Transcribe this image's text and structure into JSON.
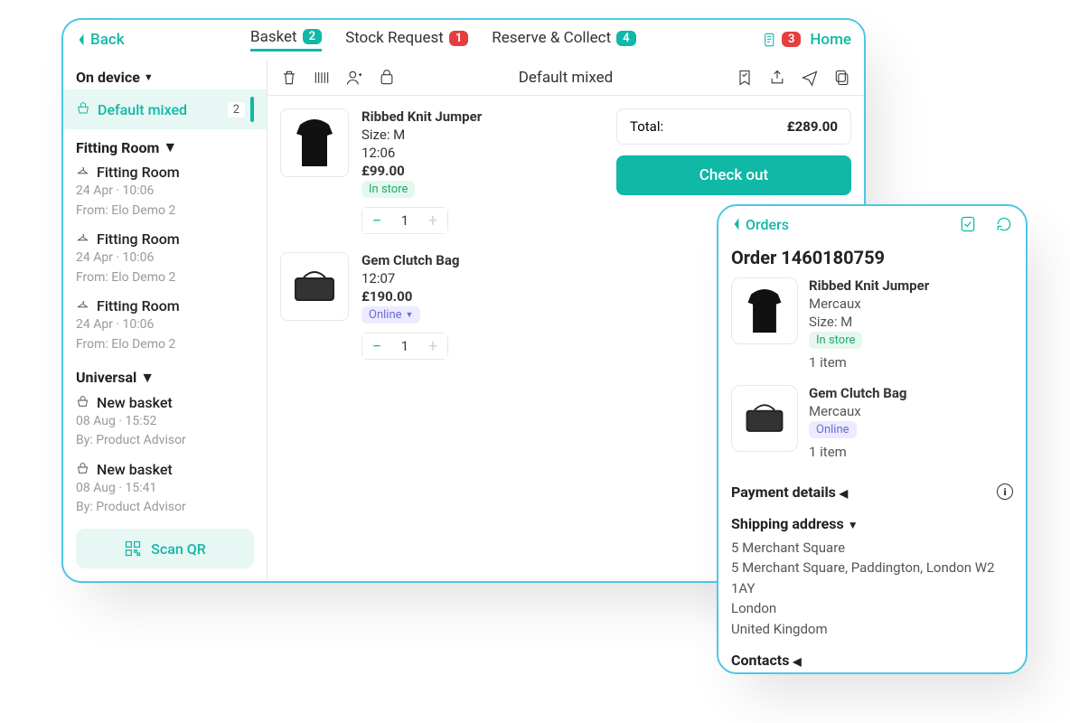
{
  "top": {
    "back": "Back",
    "tabs": [
      {
        "label": "Basket",
        "count": 2,
        "color": "green",
        "active": true
      },
      {
        "label": "Stock Request",
        "count": 1,
        "color": "red",
        "active": false
      },
      {
        "label": "Reserve & Collect",
        "count": 4,
        "color": "teal",
        "active": false
      }
    ],
    "notif_count": 3,
    "home": "Home"
  },
  "sidebar": {
    "sections": [
      {
        "title": "On device",
        "selected": {
          "label": "Default mixed",
          "count": 2
        }
      },
      {
        "title": "Fitting Room",
        "items": [
          {
            "name": "Fitting Room",
            "meta1": "24 Apr · 10:06",
            "meta2": "From: Elo Demo 2"
          },
          {
            "name": "Fitting Room",
            "meta1": "24 Apr · 10:06",
            "meta2": "From: Elo Demo 2"
          },
          {
            "name": "Fitting Room",
            "meta1": "24 Apr · 10:06",
            "meta2": "From: Elo Demo 2"
          }
        ]
      },
      {
        "title": "Universal",
        "items": [
          {
            "name": "New basket",
            "meta1": "08 Aug · 15:52",
            "meta2": "By: Product Advisor"
          },
          {
            "name": "New basket",
            "meta1": "08 Aug · 15:41",
            "meta2": "By: Product Advisor"
          }
        ]
      }
    ],
    "scan_qr": "Scan QR"
  },
  "toolbar": {
    "title": "Default mixed"
  },
  "products": [
    {
      "name": "Ribbed Knit Jumper",
      "size": "Size: M",
      "time": "12:06",
      "price": "£99.00",
      "tag": "In store",
      "tag_class": "instore",
      "qty": 1
    },
    {
      "name": "Gem Clutch Bag",
      "size": "",
      "time": "12:07",
      "price": "£190.00",
      "tag": "Online",
      "tag_class": "online",
      "qty": 1
    }
  ],
  "checkout": {
    "total_label": "Total:",
    "total_value": "£289.00",
    "button": "Check out"
  },
  "phone": {
    "back": "Orders",
    "order_title": "Order 1460180759",
    "items": [
      {
        "name": "Ribbed Knit Jumper",
        "brand": "Mercaux",
        "size": "Size: M",
        "tag": "In store",
        "tag_class": "instore",
        "qty": "1 item"
      },
      {
        "name": "Gem Clutch Bag",
        "brand": "Mercaux",
        "size": "",
        "tag": "Online",
        "tag_class": "online",
        "qty": "1 item"
      }
    ],
    "payment_label": "Payment details",
    "shipping_label": "Shipping address",
    "address": [
      "5 Merchant Square",
      "5 Merchant Square, Paddington, London W2 1AY",
      "London",
      "United Kingdom"
    ],
    "contacts_label": "Contacts"
  }
}
